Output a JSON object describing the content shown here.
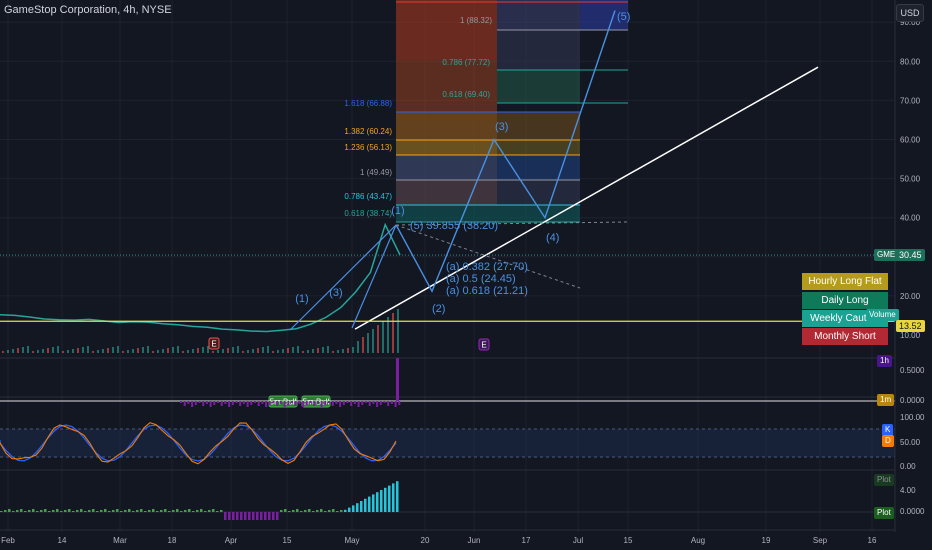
{
  "header": {
    "title": "GameStop Corporation, 4h, NYSE",
    "currency": "USD"
  },
  "price_axis": {
    "ticks": [
      "90.00",
      "80.00",
      "70.00",
      "60.00",
      "50.00",
      "40.00",
      "30.00",
      "20.00",
      "10.00"
    ],
    "current_label": "GME",
    "current_value": "30.45",
    "line_value": "13.52",
    "volume_label": "Volume"
  },
  "time_axis": {
    "labels": [
      "Feb",
      "14",
      "Mar",
      "18",
      "Apr",
      "15",
      "May",
      "20",
      "Jun",
      "17",
      "Jul",
      "15",
      "Aug",
      "19",
      "Sep",
      "16"
    ]
  },
  "fib_levels": [
    {
      "label": "1 (88.32)",
      "color": "#9598a1"
    },
    {
      "label": "0.786 (77.72)",
      "color": "#26a69a"
    },
    {
      "label": "0.618 (69.40)",
      "color": "#26a69a"
    },
    {
      "label": "1.618 (66.88)",
      "color": "#2962ff"
    },
    {
      "label": "1.382 (60.24)",
      "color": "#f7a21b"
    },
    {
      "label": "1.236 (56.13)",
      "color": "#f7a21b"
    },
    {
      "label": "1 (49.49)",
      "color": "#9598a1"
    },
    {
      "label": "0.786 (43.47)",
      "color": "#26c6da"
    },
    {
      "label": "0.618 (38.74)",
      "color": "#26a69a"
    }
  ],
  "wave_labels": {
    "w1_top": "(1)",
    "w1_left": "(1)",
    "w3_left": "(3)",
    "w2": "(2)",
    "w3": "(3)",
    "w4": "(4)",
    "w5": "(5)",
    "w5_early": "(5) 39.855 (38.20)",
    "ret_382": "(a) 0.382 (27.70)",
    "ret_50": "(a) 0.5 (24.45)",
    "ret_618": "(a) 0.618 (21.21)"
  },
  "markers": {
    "earnings_1": "E",
    "earnings_2": "E",
    "bull_1": "5m Bull",
    "bull_2": "5m Bull"
  },
  "signals": [
    {
      "label": "Hourly Long Flat",
      "color": "#b59b1b"
    },
    {
      "label": "Daily Long",
      "color": "#0f7a5a"
    },
    {
      "label": "Weekly Caution Long",
      "color": "#1aa393"
    },
    {
      "label": "Monthly Short",
      "color": "#b22833"
    }
  ],
  "oscillator_panel": {
    "tag": "1h",
    "ticks": [
      "0.5000",
      "0.0000"
    ],
    "tag2": "1m"
  },
  "stoch_panel": {
    "ticks": [
      "100.00",
      "50.00",
      "0.00"
    ],
    "k_label": "K",
    "d_label": "D"
  },
  "momentum_panel": {
    "ticks": [
      "4.00",
      "0.0000"
    ],
    "plot_faded": "Plot",
    "plot": "Plot"
  },
  "chart_data": {
    "type": "line",
    "title": "GameStop Corporation, 4h, NYSE",
    "y_range": [
      0,
      95
    ],
    "x_labels": [
      "Feb",
      "14",
      "Mar",
      "18",
      "Apr",
      "15",
      "May",
      "20",
      "Jun",
      "17",
      "Jul",
      "15",
      "Aug",
      "19",
      "Sep",
      "16"
    ],
    "price_series": [
      15.2,
      15.0,
      14.6,
      14.1,
      13.9,
      13.8,
      14.0,
      13.6,
      13.2,
      13.4,
      13.3,
      12.9,
      12.6,
      12.2,
      12.0,
      11.5,
      11.3,
      11.0,
      10.9,
      11.2,
      11.6,
      12.8,
      14.5,
      17.0,
      21.0,
      26.0,
      38.2,
      30.45
    ],
    "elliott_wave_projection": [
      {
        "label": "(1)",
        "value": 38.2
      },
      {
        "label": "(2)",
        "value": 21.2
      },
      {
        "label": "(3)",
        "value": 60.0
      },
      {
        "label": "(4)",
        "value": 40.0
      },
      {
        "label": "(5)",
        "value": 93.0
      }
    ],
    "trendline": {
      "start": 11.5,
      "end": 78.5
    },
    "current_price": 30.45,
    "horizontal_line": 13.52
  }
}
